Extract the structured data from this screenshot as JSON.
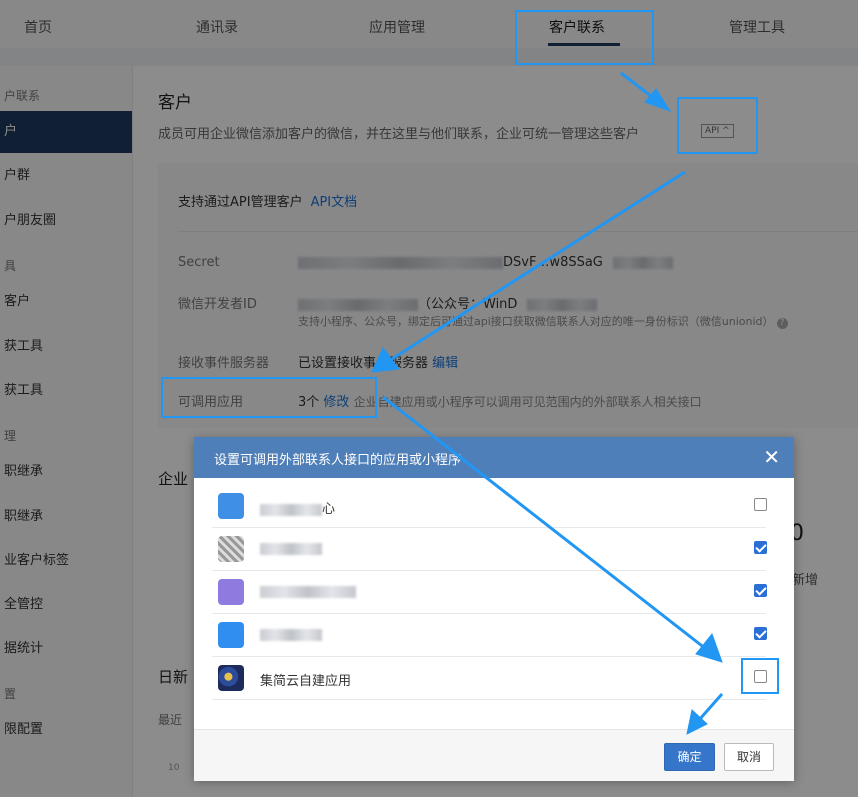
{
  "top_nav": {
    "tabs": [
      {
        "label": "首页"
      },
      {
        "label": "通讯录"
      },
      {
        "label": "应用管理"
      },
      {
        "label": "客户联系",
        "active": true
      },
      {
        "label": "管理工具"
      }
    ]
  },
  "sidebar": {
    "items": [
      {
        "label": "户联系",
        "type": "group"
      },
      {
        "label": "户",
        "active": true
      },
      {
        "label": "户群"
      },
      {
        "label": "户朋友圈"
      },
      {
        "label": "具",
        "type": "group"
      },
      {
        "label": "客户"
      },
      {
        "label": "获工具"
      },
      {
        "label": "获工具"
      },
      {
        "label": "理",
        "type": "group"
      },
      {
        "label": "职继承"
      },
      {
        "label": "职继承"
      },
      {
        "label": "业客户标签"
      },
      {
        "label": "全管控"
      },
      {
        "label": "据统计"
      },
      {
        "label": "置",
        "type": "group"
      },
      {
        "label": "限配置"
      }
    ]
  },
  "main": {
    "title": "客户",
    "description": "成员可用企业微信添加客户的微信，并在这里与他们联系，企业可统一管理这些客户",
    "api_tag": "API ^",
    "api_card": {
      "heading": "支持通过API管理客户",
      "doc_link": "API文档",
      "secret_label": "Secret",
      "secret_value_visible": "DSvF…w8SSaG",
      "dev_id_label": "微信开发者ID",
      "dev_id_value_visible": "（公众号：WinD",
      "dev_id_hint": "支持小程序、公众号，绑定后可通过api接口获取微信联系人对应的唯一身份标识（微信unionid）",
      "event_server_label": "接收事件服务器",
      "event_server_value": "已设置接收事件服务器",
      "event_server_edit": "编辑",
      "callable_apps_label": "可调用应用",
      "callable_apps_count": "3个",
      "callable_apps_edit": "修改",
      "callable_apps_hint": "企业自建应用或小程序可以调用可见范围内的外部联系人相关接口"
    },
    "partial_texts": {
      "enterprise": "企业",
      "daily_new": "日新",
      "recent": "最近",
      "axis_10": "10",
      "right_zero": "0",
      "right_new": "新增"
    }
  },
  "modal": {
    "title": "设置可调用外部联系人接口的应用或小程序",
    "close_icon": "close-icon",
    "apps": [
      {
        "name": "心",
        "checked": false,
        "icon_color": "#3f8fe6"
      },
      {
        "name": "",
        "checked": true,
        "icon_color": "#9a9a9a"
      },
      {
        "name": "",
        "checked": true,
        "icon_color": "#8f7be0"
      },
      {
        "name": "",
        "checked": true,
        "icon_color": "#2f8ef0"
      },
      {
        "name": "集简云自建应用",
        "checked": false,
        "icon_color": "#1d2a5c"
      }
    ],
    "ok_label": "确定",
    "cancel_label": "取消"
  },
  "annotation_color": "#2196f3"
}
